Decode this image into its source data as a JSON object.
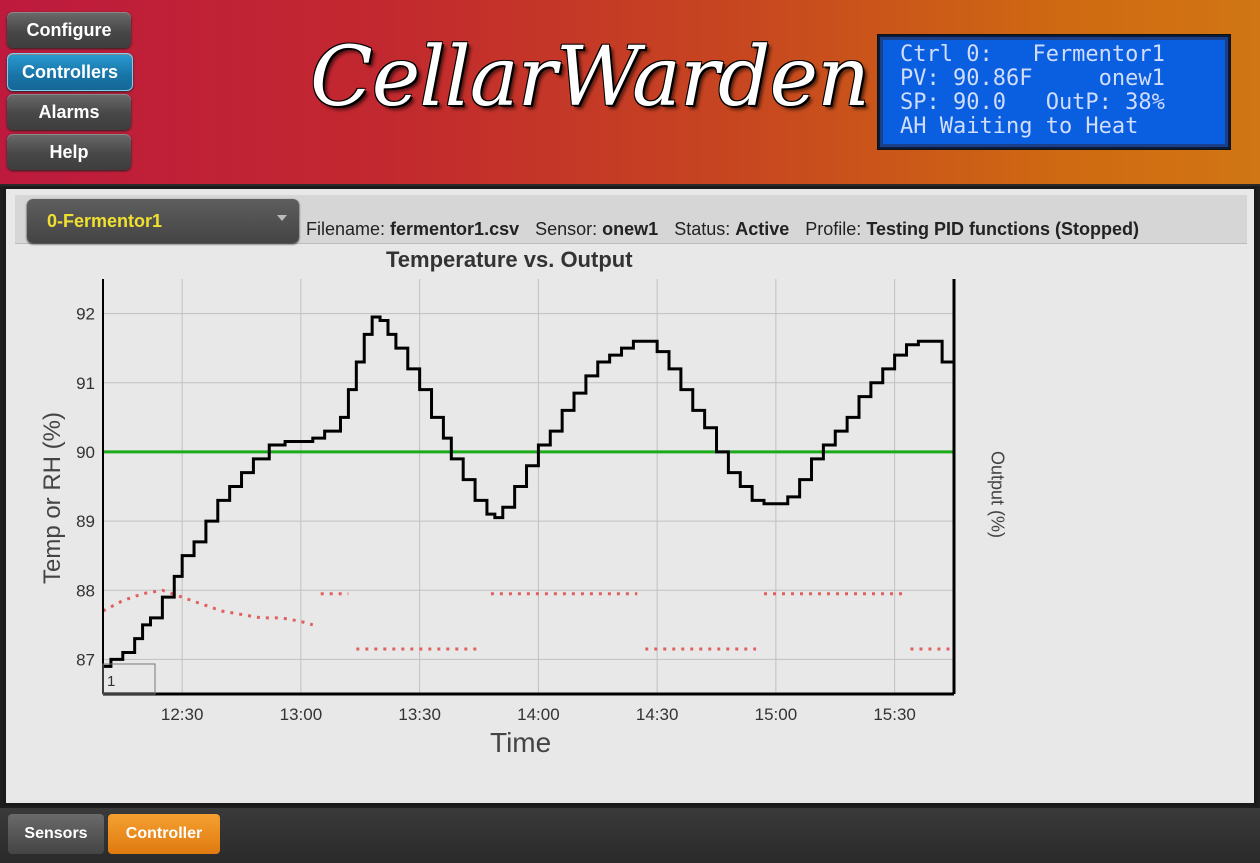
{
  "nav": {
    "configure": "Configure",
    "controllers": "Controllers",
    "alarms": "Alarms",
    "help": "Help"
  },
  "logo": "CellarWarden",
  "lcd": {
    "line1": "Ctrl 0:   Fermentor1",
    "line2": "PV: 90.86F     onew1",
    "line3": "SP: 90.0   OutP: 38%",
    "line4": "AH Waiting to Heat"
  },
  "controller_select": {
    "value": "0-Fermentor1"
  },
  "info": {
    "filename_label": "Filename:",
    "filename": "fermentor1.csv",
    "sensor_label": "Sensor:",
    "sensor": "onew1",
    "status_label": "Status:",
    "status": "Active",
    "profile_label": "Profile:",
    "profile": "Testing PID functions (Stopped)"
  },
  "chart_data": {
    "type": "line",
    "title": "Temperature vs. Output",
    "xlabel": "Time",
    "ylabel": "Temp or RH (%)",
    "y2label": "Output (%)",
    "ylim": [
      86.5,
      92.5
    ],
    "yticks": [
      "87",
      "88",
      "89",
      "90",
      "91",
      "92"
    ],
    "xlim": [
      "12:10",
      "15:45"
    ],
    "xticks": [
      "12:30",
      "13:00",
      "13:30",
      "14:00",
      "14:30",
      "15:00",
      "15:30"
    ],
    "grid": true,
    "legend_box": "1",
    "series": [
      {
        "color": "#000000",
        "points": [
          [
            "12:10",
            86.9
          ],
          [
            "12:12",
            87.0
          ],
          [
            "12:15",
            87.1
          ],
          [
            "12:18",
            87.3
          ],
          [
            "12:20",
            87.5
          ],
          [
            "12:22",
            87.6
          ],
          [
            "12:25",
            87.9
          ],
          [
            "12:28",
            88.2
          ],
          [
            "12:30",
            88.5
          ],
          [
            "12:33",
            88.7
          ],
          [
            "12:36",
            89.0
          ],
          [
            "12:39",
            89.3
          ],
          [
            "12:42",
            89.5
          ],
          [
            "12:45",
            89.7
          ],
          [
            "12:48",
            89.9
          ],
          [
            "12:52",
            90.1
          ],
          [
            "12:56",
            90.15
          ],
          [
            "13:00",
            90.15
          ],
          [
            "13:03",
            90.2
          ],
          [
            "13:06",
            90.3
          ],
          [
            "13:08",
            90.3
          ],
          [
            "13:10",
            90.5
          ],
          [
            "13:12",
            90.9
          ],
          [
            "13:14",
            91.3
          ],
          [
            "13:16",
            91.7
          ],
          [
            "13:18",
            91.95
          ],
          [
            "13:20",
            91.9
          ],
          [
            "13:22",
            91.7
          ],
          [
            "13:24",
            91.5
          ],
          [
            "13:27",
            91.2
          ],
          [
            "13:30",
            90.9
          ],
          [
            "13:33",
            90.5
          ],
          [
            "13:36",
            90.2
          ],
          [
            "13:38",
            89.9
          ],
          [
            "13:41",
            89.6
          ],
          [
            "13:44",
            89.3
          ],
          [
            "13:47",
            89.1
          ],
          [
            "13:49",
            89.05
          ],
          [
            "13:51",
            89.2
          ],
          [
            "13:54",
            89.5
          ],
          [
            "13:57",
            89.8
          ],
          [
            "14:00",
            90.1
          ],
          [
            "14:03",
            90.3
          ],
          [
            "14:06",
            90.6
          ],
          [
            "14:09",
            90.85
          ],
          [
            "14:12",
            91.1
          ],
          [
            "14:15",
            91.3
          ],
          [
            "14:18",
            91.4
          ],
          [
            "14:21",
            91.5
          ],
          [
            "14:24",
            91.6
          ],
          [
            "14:27",
            91.6
          ],
          [
            "14:30",
            91.45
          ],
          [
            "14:33",
            91.2
          ],
          [
            "14:36",
            90.9
          ],
          [
            "14:39",
            90.6
          ],
          [
            "14:42",
            90.35
          ],
          [
            "14:45",
            90.0
          ],
          [
            "14:48",
            89.7
          ],
          [
            "14:51",
            89.5
          ],
          [
            "14:54",
            89.3
          ],
          [
            "14:57",
            89.25
          ],
          [
            "15:00",
            89.25
          ],
          [
            "15:03",
            89.35
          ],
          [
            "15:06",
            89.6
          ],
          [
            "15:09",
            89.9
          ],
          [
            "15:12",
            90.1
          ],
          [
            "15:15",
            90.3
          ],
          [
            "15:18",
            90.5
          ],
          [
            "15:21",
            90.8
          ],
          [
            "15:24",
            91.0
          ],
          [
            "15:27",
            91.2
          ],
          [
            "15:30",
            91.4
          ],
          [
            "15:33",
            91.55
          ],
          [
            "15:36",
            91.6
          ],
          [
            "15:39",
            91.6
          ],
          [
            "15:42",
            91.3
          ],
          [
            "15:45",
            91.05
          ]
        ]
      },
      {
        "color": "#1aaa1a",
        "points": [
          [
            "12:10",
            90.0
          ],
          [
            "15:45",
            90.0
          ]
        ]
      },
      {
        "color": "#e06060",
        "dotted": true,
        "segments": [
          [
            [
              "12:10",
              87.7
            ],
            [
              "12:15",
              87.85
            ],
            [
              "12:20",
              87.95
            ],
            [
              "12:25",
              88.0
            ],
            [
              "12:30",
              87.9
            ],
            [
              "12:35",
              87.8
            ],
            [
              "12:40",
              87.7
            ],
            [
              "12:45",
              87.65
            ],
            [
              "12:50",
              87.6
            ],
            [
              "12:55",
              87.6
            ],
            [
              "13:00",
              87.55
            ],
            [
              "13:03",
              87.5
            ]
          ],
          [
            [
              "13:05",
              87.95
            ],
            [
              "13:12",
              87.95
            ]
          ],
          [
            [
              "13:14",
              87.15
            ],
            [
              "13:45",
              87.15
            ]
          ],
          [
            [
              "13:48",
              87.95
            ],
            [
              "14:25",
              87.95
            ]
          ],
          [
            [
              "14:27",
              87.15
            ],
            [
              "14:55",
              87.15
            ]
          ],
          [
            [
              "14:57",
              87.95
            ],
            [
              "15:32",
              87.95
            ]
          ],
          [
            [
              "15:34",
              87.15
            ],
            [
              "15:45",
              87.15
            ]
          ]
        ]
      }
    ]
  },
  "tabs": {
    "sensors": "Sensors",
    "controller": "Controller"
  }
}
